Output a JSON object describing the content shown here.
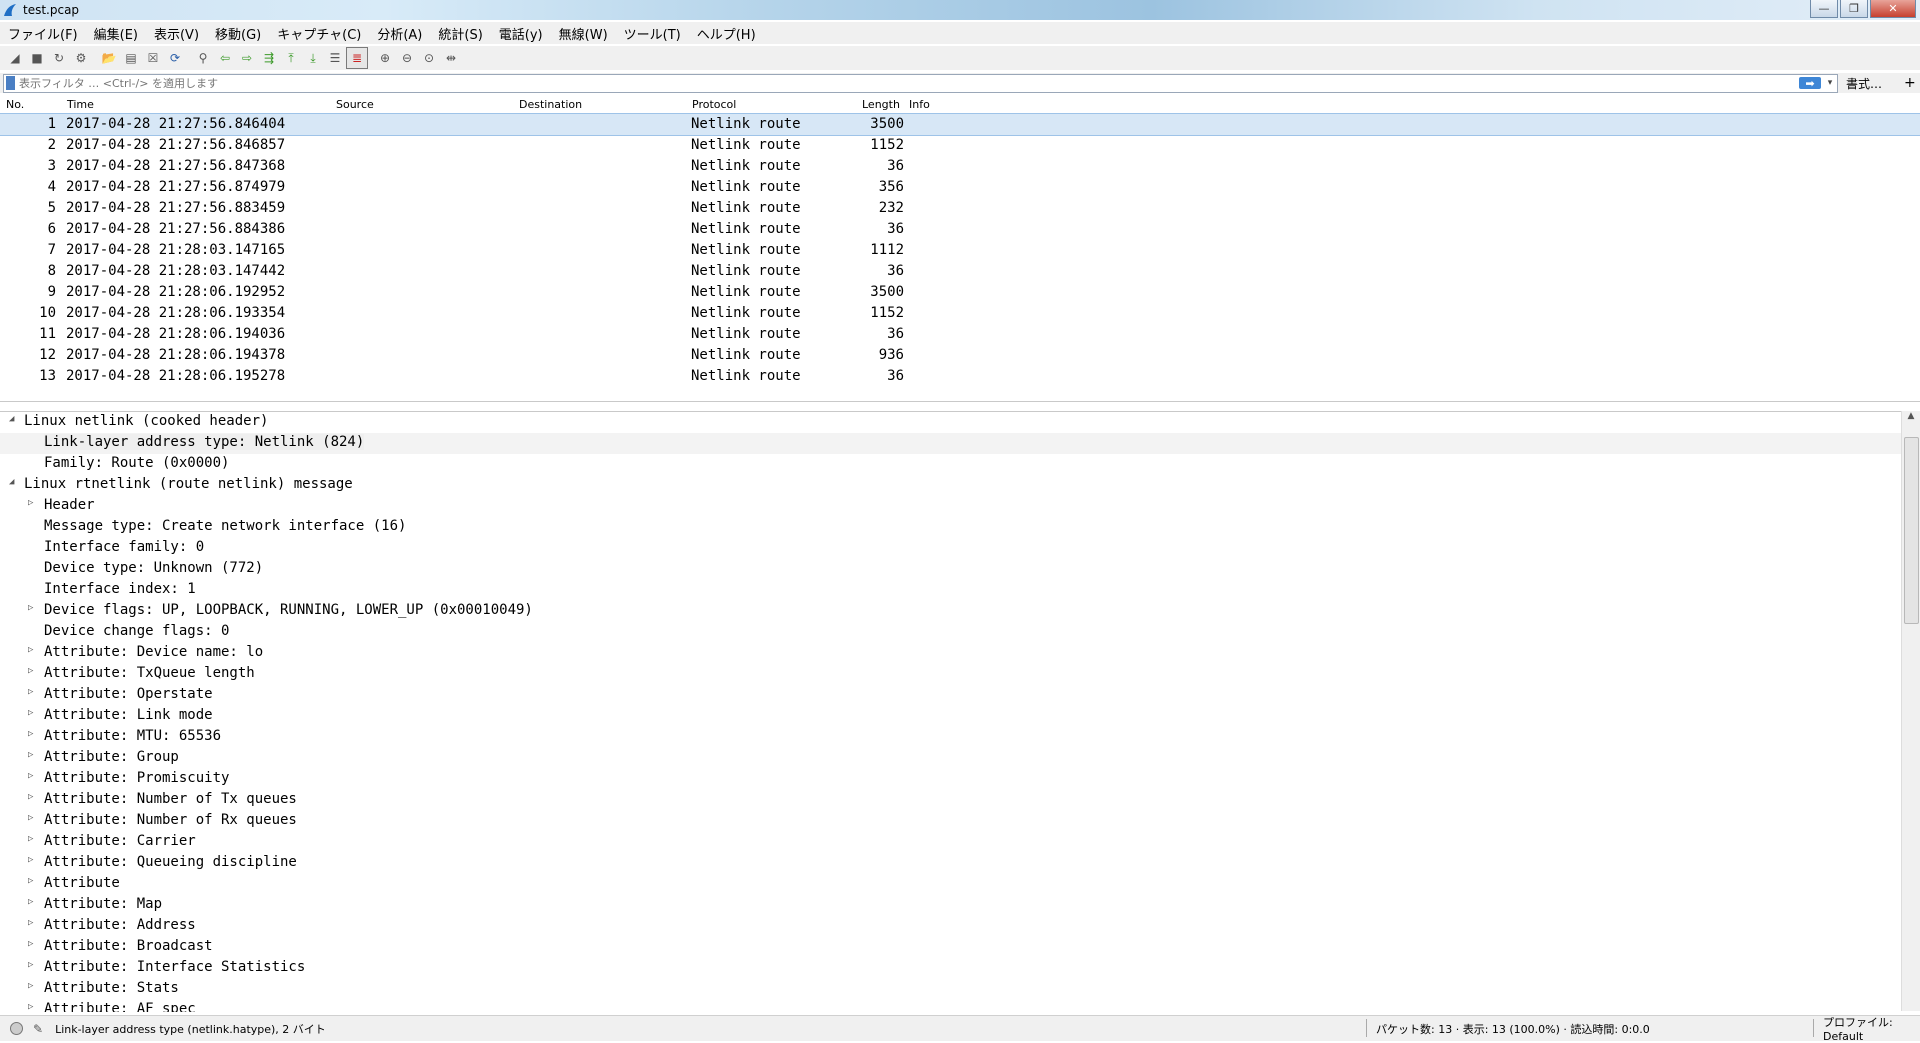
{
  "window": {
    "title": "test.pcap"
  },
  "menu": [
    "ファイル(F)",
    "編集(E)",
    "表示(V)",
    "移動(G)",
    "キャプチャ(C)",
    "分析(A)",
    "統計(S)",
    "電話(y)",
    "無線(W)",
    "ツール(T)",
    "ヘルプ(H)"
  ],
  "filter": {
    "placeholder": "表示フィルタ … <Ctrl-/> を適用します",
    "apply_arrow": "➡",
    "dropdown": "▾",
    "format_label": "書式…",
    "add_label": "+"
  },
  "columns": {
    "no": "No.",
    "time": "Time",
    "source": "Source",
    "destination": "Destination",
    "protocol": "Protocol",
    "length": "Length",
    "info": "Info"
  },
  "packets": [
    {
      "no": "1",
      "time": "2017-04-28 21:27:56.846404",
      "protocol": "Netlink route",
      "length": "3500"
    },
    {
      "no": "2",
      "time": "2017-04-28 21:27:56.846857",
      "protocol": "Netlink route",
      "length": "1152"
    },
    {
      "no": "3",
      "time": "2017-04-28 21:27:56.847368",
      "protocol": "Netlink route",
      "length": "36"
    },
    {
      "no": "4",
      "time": "2017-04-28 21:27:56.874979",
      "protocol": "Netlink route",
      "length": "356"
    },
    {
      "no": "5",
      "time": "2017-04-28 21:27:56.883459",
      "protocol": "Netlink route",
      "length": "232"
    },
    {
      "no": "6",
      "time": "2017-04-28 21:27:56.884386",
      "protocol": "Netlink route",
      "length": "36"
    },
    {
      "no": "7",
      "time": "2017-04-28 21:28:03.147165",
      "protocol": "Netlink route",
      "length": "1112"
    },
    {
      "no": "8",
      "time": "2017-04-28 21:28:03.147442",
      "protocol": "Netlink route",
      "length": "36"
    },
    {
      "no": "9",
      "time": "2017-04-28 21:28:06.192952",
      "protocol": "Netlink route",
      "length": "3500"
    },
    {
      "no": "10",
      "time": "2017-04-28 21:28:06.193354",
      "protocol": "Netlink route",
      "length": "1152"
    },
    {
      "no": "11",
      "time": "2017-04-28 21:28:06.194036",
      "protocol": "Netlink route",
      "length": "36"
    },
    {
      "no": "12",
      "time": "2017-04-28 21:28:06.194378",
      "protocol": "Netlink route",
      "length": "936"
    },
    {
      "no": "13",
      "time": "2017-04-28 21:28:06.195278",
      "protocol": "Netlink route",
      "length": "36"
    }
  ],
  "details": [
    {
      "level": 0,
      "arrow": "◢",
      "text": "Linux netlink (cooked header)"
    },
    {
      "level": 1,
      "arrow": "",
      "text": "Link-layer address type: Netlink (824)"
    },
    {
      "level": 1,
      "arrow": "",
      "text": "Family: Route (0x0000)"
    },
    {
      "level": 0,
      "arrow": "◢",
      "text": "Linux rtnetlink (route netlink) message"
    },
    {
      "level": 1,
      "arrow": "▷",
      "text": "Header"
    },
    {
      "level": 1,
      "arrow": "",
      "text": "Message type: Create network interface (16)"
    },
    {
      "level": 1,
      "arrow": "",
      "text": "Interface family: 0"
    },
    {
      "level": 1,
      "arrow": "",
      "text": "Device type: Unknown (772)"
    },
    {
      "level": 1,
      "arrow": "",
      "text": "Interface index: 1"
    },
    {
      "level": 1,
      "arrow": "▷",
      "text": "Device flags: UP, LOOPBACK, RUNNING, LOWER_UP (0x00010049)"
    },
    {
      "level": 1,
      "arrow": "",
      "text": "Device change flags: 0"
    },
    {
      "level": 1,
      "arrow": "▷",
      "text": "Attribute: Device name: lo"
    },
    {
      "level": 1,
      "arrow": "▷",
      "text": "Attribute: TxQueue length"
    },
    {
      "level": 1,
      "arrow": "▷",
      "text": "Attribute: Operstate"
    },
    {
      "level": 1,
      "arrow": "▷",
      "text": "Attribute: Link mode"
    },
    {
      "level": 1,
      "arrow": "▷",
      "text": "Attribute: MTU: 65536"
    },
    {
      "level": 1,
      "arrow": "▷",
      "text": "Attribute: Group"
    },
    {
      "level": 1,
      "arrow": "▷",
      "text": "Attribute: Promiscuity"
    },
    {
      "level": 1,
      "arrow": "▷",
      "text": "Attribute: Number of Tx queues"
    },
    {
      "level": 1,
      "arrow": "▷",
      "text": "Attribute: Number of Rx queues"
    },
    {
      "level": 1,
      "arrow": "▷",
      "text": "Attribute: Carrier"
    },
    {
      "level": 1,
      "arrow": "▷",
      "text": "Attribute: Queueing discipline"
    },
    {
      "level": 1,
      "arrow": "▷",
      "text": "Attribute"
    },
    {
      "level": 1,
      "arrow": "▷",
      "text": "Attribute: Map"
    },
    {
      "level": 1,
      "arrow": "▷",
      "text": "Attribute: Address"
    },
    {
      "level": 1,
      "arrow": "▷",
      "text": "Attribute: Broadcast"
    },
    {
      "level": 1,
      "arrow": "▷",
      "text": "Attribute: Interface Statistics"
    },
    {
      "level": 1,
      "arrow": "▷",
      "text": "Attribute: Stats"
    },
    {
      "level": 1,
      "arrow": "▷",
      "text": "Attribute: AF_spec"
    }
  ],
  "status": {
    "field_info": "Link-layer address type (netlink.hatype), 2 バイト",
    "packets": "パケット数: 13 · 表示: 13 (100.0%) · 読込時間: 0:0.0",
    "profile": "プロファイル: Default"
  }
}
